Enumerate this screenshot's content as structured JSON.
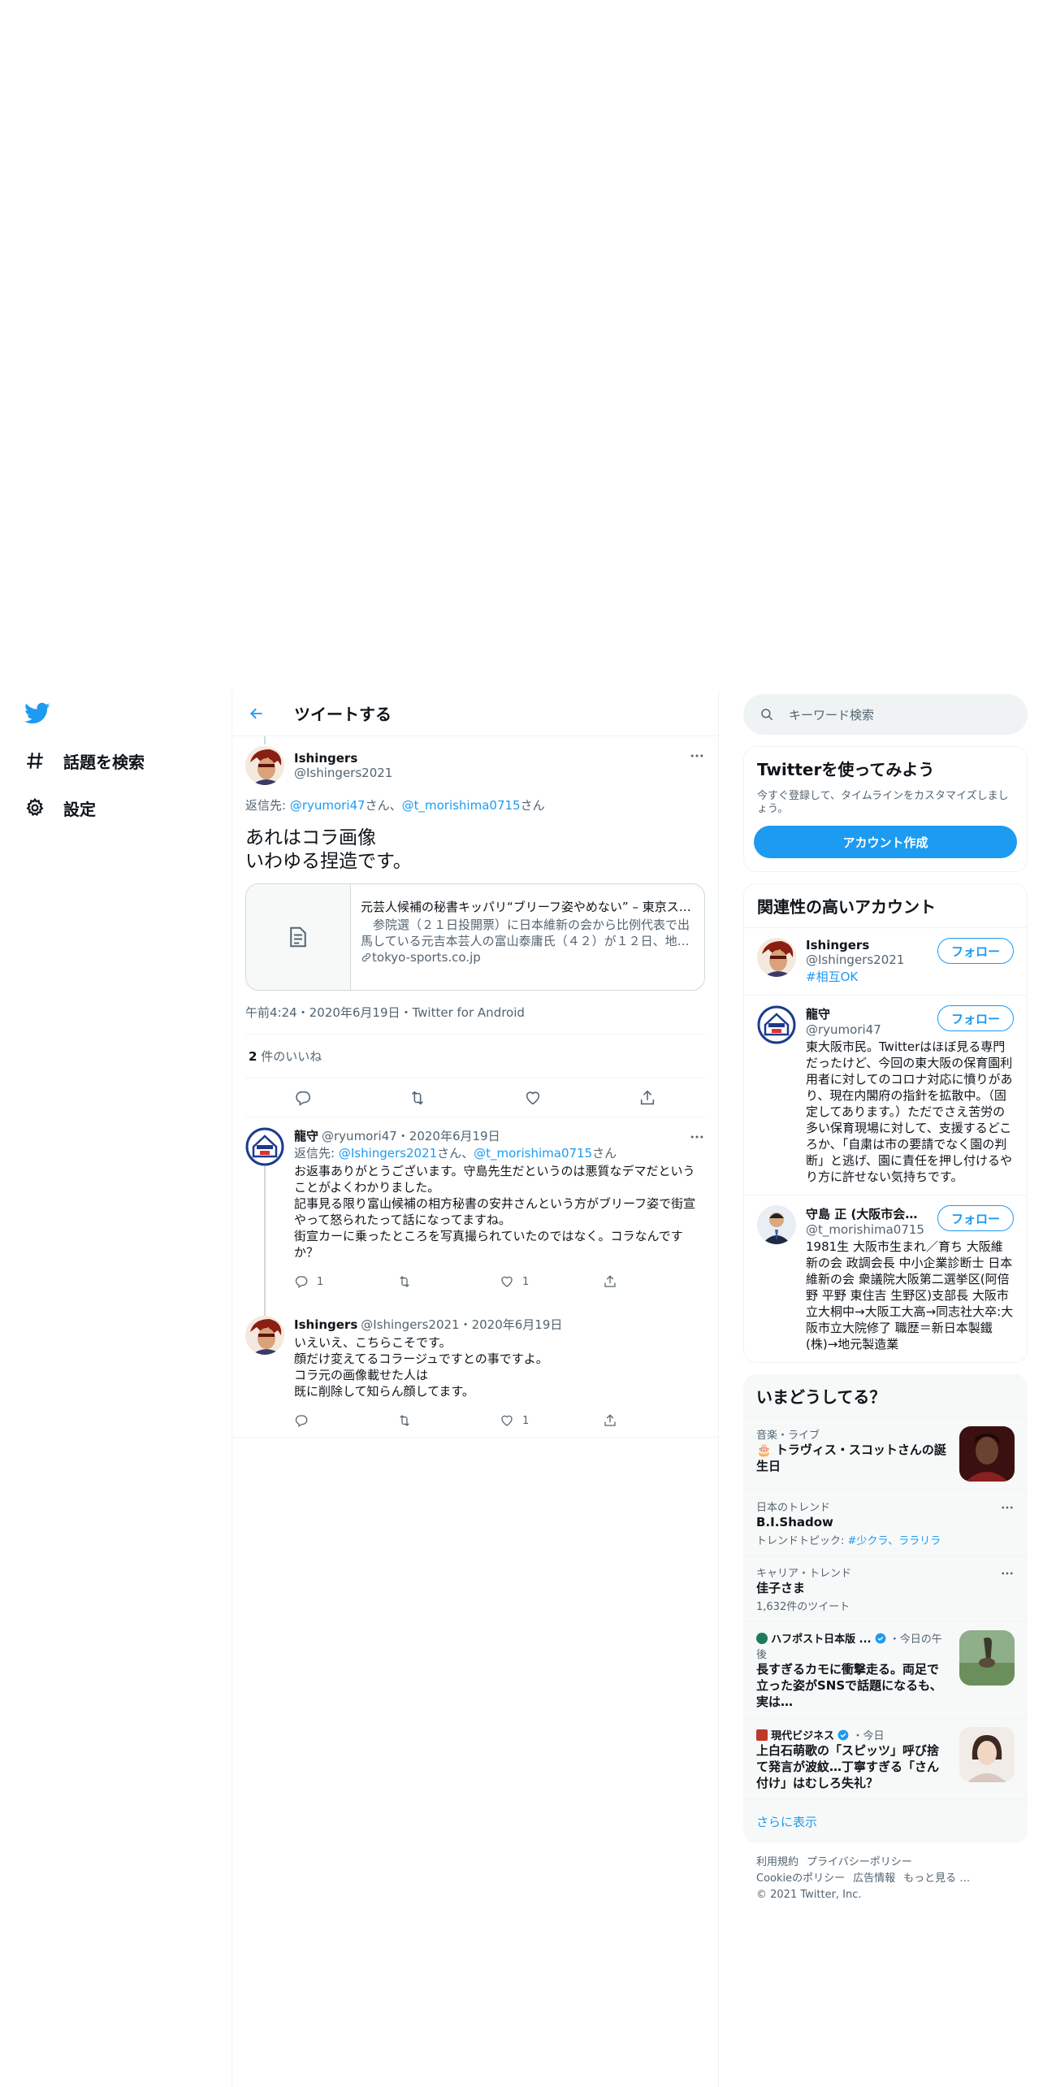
{
  "nav": {
    "items": [
      {
        "label": "話題を検索",
        "icon": "hashtag-icon"
      },
      {
        "label": "設定",
        "icon": "gear-icon"
      }
    ]
  },
  "header": {
    "title": "ツイートする"
  },
  "main_tweet": {
    "name": "Ishingers",
    "handle": "@Ishingers2021",
    "reply_prefix": "返信先: ",
    "reply_user1": "@ryumori47",
    "reply_san1": "さん、",
    "reply_user2": "@t_morishima0715",
    "reply_san2": "さん",
    "text": "あれはコラ画像\nいわゆる捏造です。",
    "card": {
      "title": "元芸人候補の秘書キッパリ“ブリーフ姿やめない” – 東京ス…",
      "description": "　参院選（２１日投開票）に日本維新の会から比例代表で出馬している元吉本芸人の富山泰庸氏（４２）が１２日、地…",
      "domain": "tokyo-sports.co.jp"
    },
    "meta": "午前4:24・2020年6月19日・Twitter for Android",
    "likes_count": "2",
    "likes_label": " 件のいいね"
  },
  "replies": [
    {
      "name": "龍守",
      "handle_date": "@ryumori47・2020年6月19日",
      "reply_prefix": "返信先: ",
      "reply_user1": "@Ishingers2021",
      "reply_san1": "さん、",
      "reply_user2": "@t_morishima0715",
      "reply_san2": "さん",
      "text": "お返事ありがとうございます。守島先生だというのは悪質なデマだということがよくわかりました。\n記事見る限り富山候補の相方秘書の安井さんという方がブリーフ姿で街宣やって怒られたって話になってますね。\n街宣カーに乗ったところを写真撮られていたのではなく。コラなんですか？",
      "reply_count": "1",
      "like_count": "1"
    },
    {
      "name": "Ishingers",
      "handle_date": "@Ishingers2021・2020年6月19日",
      "text": "いえいえ、こちらこそです。\n顔だけ変えてるコラージュですとの事ですよ。\nコラ元の画像載せた人は\n既に削除して知らん顔してます。",
      "reply_count": "",
      "like_count": "1"
    }
  ],
  "search": {
    "placeholder": "キーワード検索"
  },
  "signup": {
    "title": "Twitterを使ってみよう",
    "desc": "今すぐ登録して、タイムラインをカスタマイズしましょう。",
    "button": "アカウント作成"
  },
  "related": {
    "title": "関連性の高いアカウント",
    "follow_label": "フォロー",
    "accounts": [
      {
        "name": "Ishingers",
        "handle": "@Ishingers2021",
        "bio": "#相互OK"
      },
      {
        "name": "龍守",
        "handle": "@ryumori47",
        "bio": "東大阪市民。Twitterはほぼ見る専門だったけど、今回の東大阪の保育園利用者に対してのコロナ対応に憤りがあり、現在内閣府の指針を拡散中。（固定してあります。）ただでさえ苦労の多い保育現場に対して、支援するどころか、「自粛は市の要請でなく園の判断」と逃げ、園に責任を押し付けるやり方に許せない気持ちです。"
      },
      {
        "name": "守島 正 (大阪市会議…",
        "handle": "@t_morishima0715",
        "bio": "1981生 大阪市生まれ／育ち 大阪維新の会 政調会長 中小企業診断士 日本維新の会 衆議院大阪第二選挙区(阿倍野 平野 東住吉 生野区)支部長 大阪市立大桐中→大阪工大高→同志社大卒:大阪市立大院修了 職歴＝新日本製鐵(株)→地元製造業"
      }
    ]
  },
  "trends": {
    "title": "いまどうしてる？",
    "items": [
      {
        "context": "音楽・ライブ",
        "title": "🎂 トラヴィス・スコットさんの誕生日",
        "sub": ""
      },
      {
        "context": "日本のトレンド",
        "title": "B.I.Shadow",
        "sub_prefix": "トレンドトピック: ",
        "sub_link": "#少クラ、ララリラ"
      },
      {
        "context": "キャリア・トレンド",
        "title": "佳子さま",
        "sub": "1,632件のツイート"
      },
      {
        "context": "ハフポスト日本版 ...",
        "context_suffix": "・今日の午後",
        "title": "長すぎるカモに衝撃走る。両足で立った姿がSNSで話題になるも、実は…"
      },
      {
        "context": "現代ビジネス",
        "context_suffix": "・今日",
        "title": "上白石萌歌の「スピッツ」呼び捨て発言が波紋…丁寧すぎる「さん付け」はむしろ失礼？"
      }
    ],
    "show_more": "さらに表示"
  },
  "footer": {
    "links": [
      "利用規約",
      "プライバシーポリシー",
      "Cookieのポリシー",
      "広告情報",
      "もっと見る …"
    ],
    "copyright": "© 2021 Twitter, Inc."
  },
  "colors": {
    "accent": "#1d9bf0",
    "text": "#0f1419",
    "secondary": "#536471"
  }
}
